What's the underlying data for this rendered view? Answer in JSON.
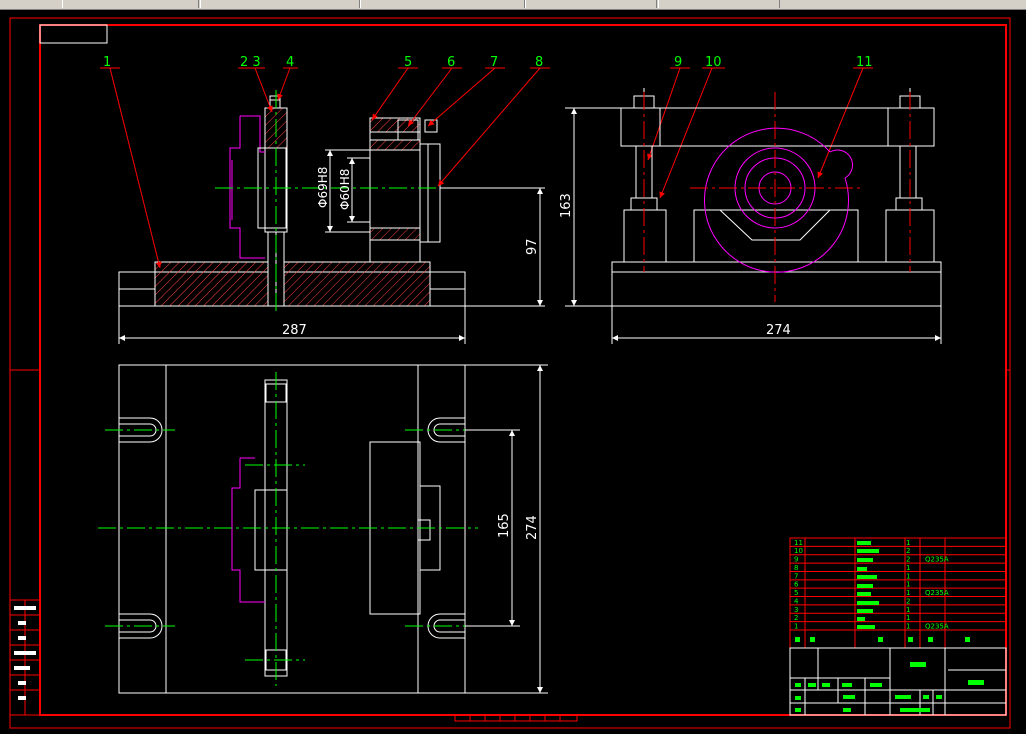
{
  "balloons": [
    {
      "id": "1",
      "label": "1"
    },
    {
      "id": "2",
      "label": "2 3"
    },
    {
      "id": "4",
      "label": "4"
    },
    {
      "id": "5",
      "label": "5"
    },
    {
      "id": "6",
      "label": "6"
    },
    {
      "id": "7",
      "label": "7"
    },
    {
      "id": "8",
      "label": "8"
    },
    {
      "id": "9",
      "label": "9"
    },
    {
      "id": "10",
      "label": "10"
    },
    {
      "id": "11",
      "label": "11"
    }
  ],
  "dimensions": {
    "width_front": "287",
    "width_side": "274",
    "height_side": "163",
    "height_front": "97",
    "width_top": "274",
    "slot_spacing": "165",
    "dia_outer": "Φ69H8",
    "dia_inner": "Φ60H8"
  },
  "bom": {
    "item_numbers": [
      "11",
      "10",
      "9",
      "8",
      "7",
      "6",
      "5",
      "4",
      "3",
      "2",
      "1"
    ],
    "qty": [
      "1",
      "2",
      "2",
      "1",
      "1",
      "1",
      "1",
      "2",
      "1",
      "1",
      "1"
    ],
    "materials": [
      "",
      "",
      "Q235A",
      "",
      "",
      "",
      "Q235A",
      "",
      "",
      "",
      "Q235A"
    ]
  },
  "colors": {
    "outline": "#ffffff",
    "border": "#ff0000",
    "centerline": "#00ff00",
    "part": "#ff00ff",
    "hatch": "#ff4040",
    "dimension": "#ffffff"
  }
}
